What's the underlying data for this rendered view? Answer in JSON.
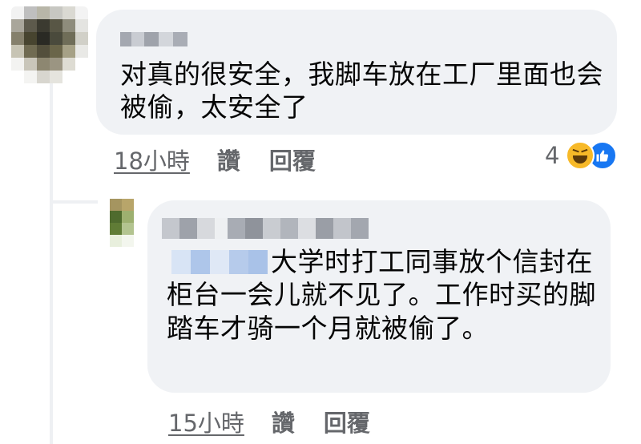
{
  "colors": {
    "bubble_bg": "#f0f2f5",
    "meta_text": "#65676b",
    "like_blue": "#1877f2",
    "haha_yellow": "#f7b928"
  },
  "comments": [
    {
      "author_name": "",
      "text": "对真的很安全，我脚车放在工厂里面也会被偷，太安全了",
      "timestamp": "18小時",
      "like_label": "讚",
      "reply_label": "回覆",
      "reaction_count": "4",
      "reaction_icons": [
        "haha-icon",
        "like-icon"
      ]
    },
    {
      "author_name": "",
      "mentioned_names": [
        ""
      ],
      "text": "大学时打工同事放个信封在柜台一会儿就不见了。工作时买的脚踏车才骑一个月就被偷了。",
      "timestamp": "15小時",
      "like_label": "讚",
      "reply_label": "回覆"
    }
  ]
}
